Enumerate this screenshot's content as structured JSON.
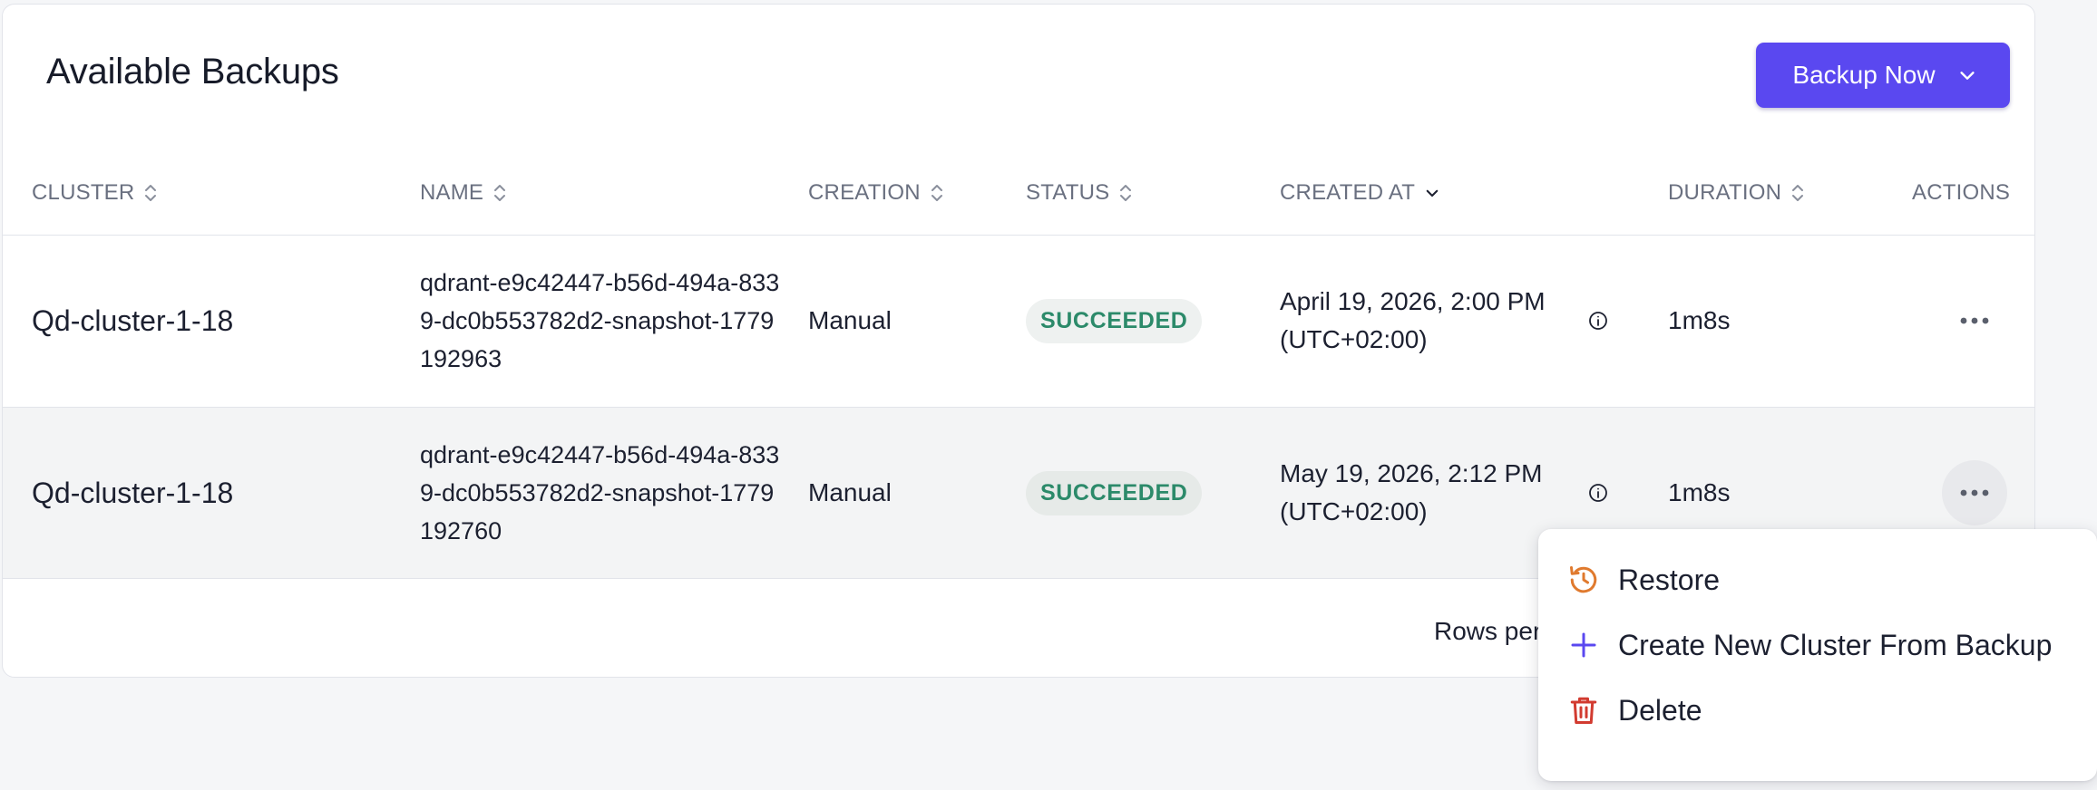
{
  "page": {
    "title": "Available Backups",
    "backup_button": {
      "label": "Backup Now"
    }
  },
  "table": {
    "columns": [
      {
        "label": "CLUSTER",
        "sort": "both"
      },
      {
        "label": "NAME",
        "sort": "both"
      },
      {
        "label": "CREATION",
        "sort": "both"
      },
      {
        "label": "STATUS",
        "sort": "both"
      },
      {
        "label": "CREATED AT",
        "sort": "desc"
      },
      {
        "label": "DURATION",
        "sort": "both"
      },
      {
        "label": "ACTIONS",
        "sort": "none"
      }
    ],
    "rows": [
      {
        "cluster": "Qd-cluster-1-18",
        "name": "qdrant-e9c42447-b56d-494a-8339-dc0b553782d2-snapshot-1779192963",
        "creation": "Manual",
        "status": "SUCCEEDED",
        "created_at_line1": "April 19, 2026, 2:00 PM",
        "created_at_line2": "(UTC+02:00)",
        "duration": "1m8s"
      },
      {
        "cluster": "Qd-cluster-1-18",
        "name": "qdrant-e9c42447-b56d-494a-8339-dc0b553782d2-snapshot-1779192760",
        "creation": "Manual",
        "status": "SUCCEEDED",
        "created_at_line1": "May 19, 2026, 2:12 PM",
        "created_at_line2": "(UTC+02:00)",
        "duration": "1m8s"
      }
    ],
    "footer": {
      "rows_per_page_label": "Rows per"
    }
  },
  "actions_menu": {
    "items": [
      {
        "label": "Restore",
        "icon": "restore-icon",
        "color": "#e07a2e"
      },
      {
        "label": "Create New Cluster From Backup",
        "icon": "plus-icon",
        "color": "#5a48f0"
      },
      {
        "label": "Delete",
        "icon": "trash-icon",
        "color": "#d23b30"
      }
    ]
  },
  "colors": {
    "accent": "#5a48f0",
    "success_text": "#2c8a6a",
    "success_bg": "#eef1f0",
    "muted_header": "#6a7080"
  }
}
